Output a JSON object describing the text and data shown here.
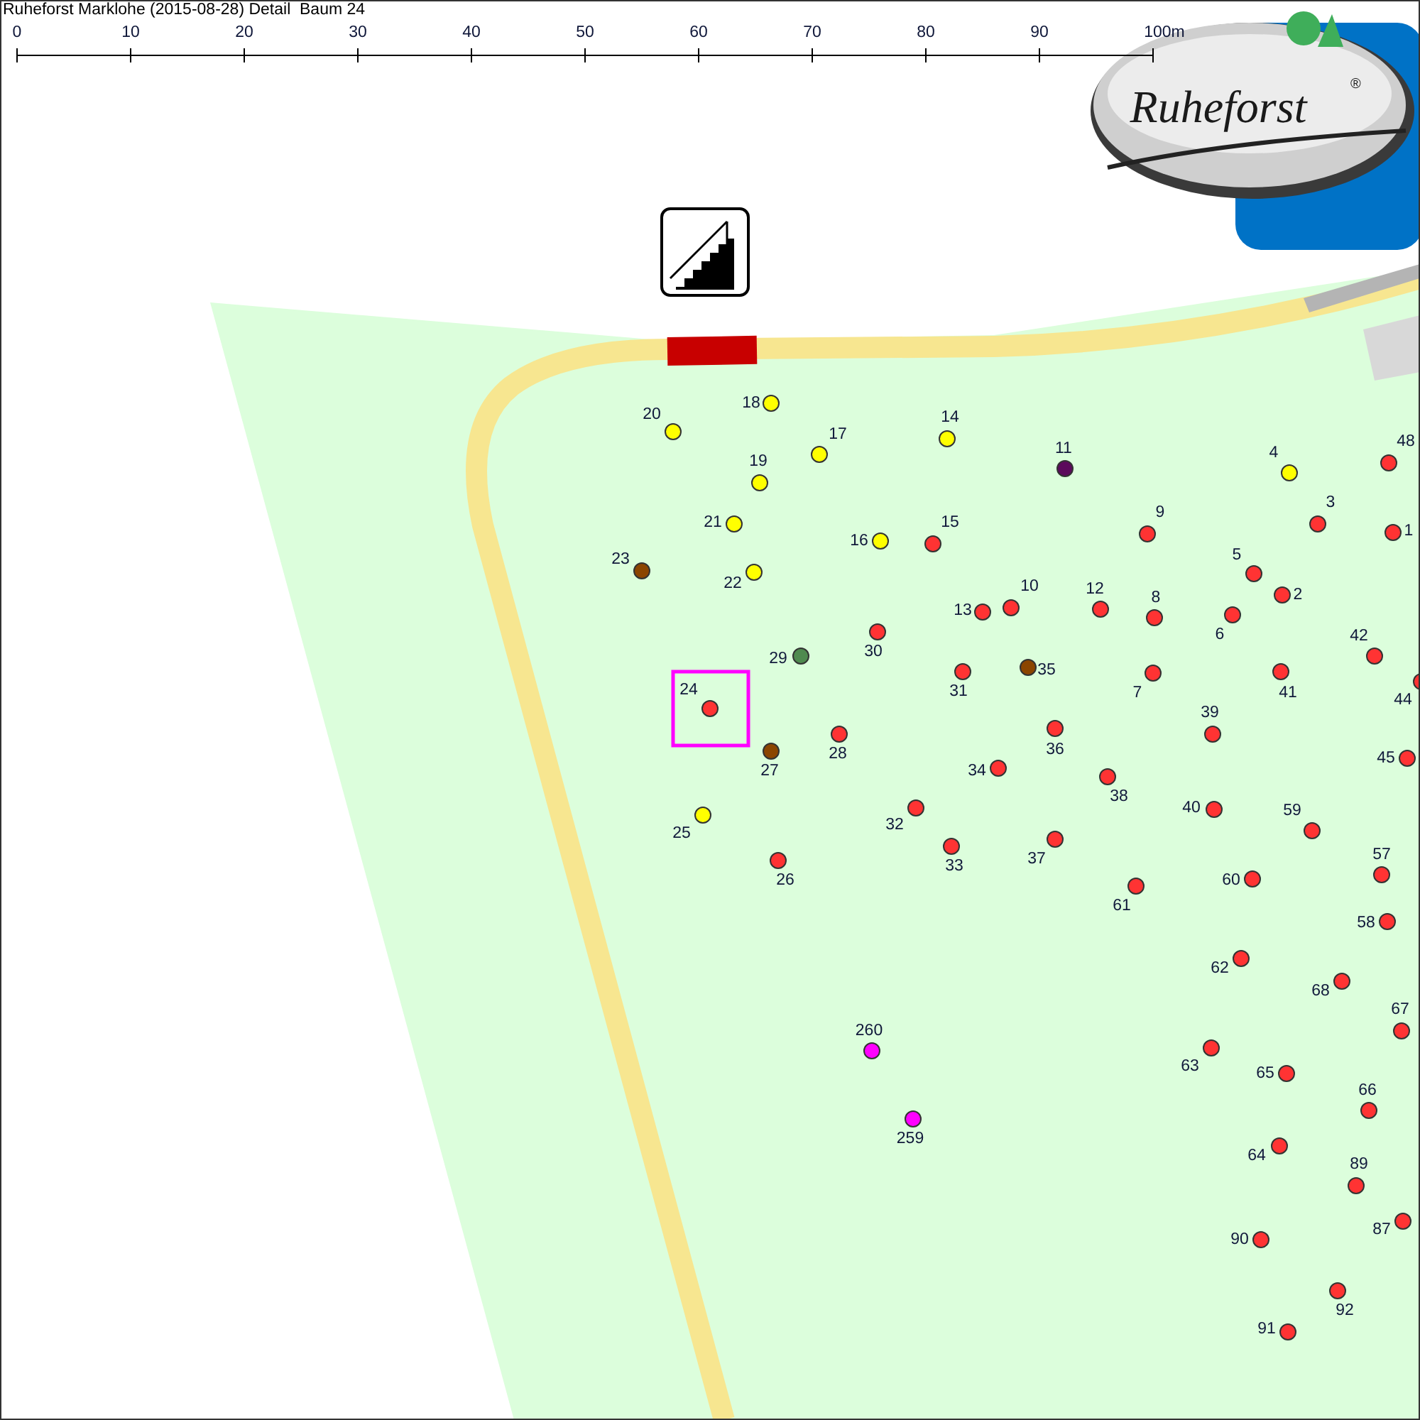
{
  "title": "Ruheforst Marklohe (2015-08-28) Detail  Baum 24",
  "scale_bar": {
    "ticks": [
      "0",
      "10",
      "20",
      "30",
      "40",
      "50",
      "60",
      "70",
      "80",
      "90",
      "100m"
    ]
  },
  "logo": {
    "name": "Ruheforst",
    "mark": "®"
  },
  "trees": [
    {
      "label": "18",
      "color": "#ffff00",
      "selected": false
    },
    {
      "label": "20",
      "color": "#ffff00",
      "selected": false
    },
    {
      "label": "14",
      "color": "#ffff00",
      "selected": false
    },
    {
      "label": "17",
      "color": "#ffff00",
      "selected": false
    },
    {
      "label": "48",
      "color": "#ff3333",
      "selected": false
    },
    {
      "label": "11",
      "color": "#5c0a5c",
      "selected": false
    },
    {
      "label": "4",
      "color": "#ffff00",
      "selected": false
    },
    {
      "label": "19",
      "color": "#ffff00",
      "selected": false
    },
    {
      "label": "21",
      "color": "#ffff00",
      "selected": false
    },
    {
      "label": "3",
      "color": "#ff3333",
      "selected": false
    },
    {
      "label": "1",
      "color": "#ff3333",
      "selected": false
    },
    {
      "label": "9",
      "color": "#ff3333",
      "selected": false
    },
    {
      "label": "16",
      "color": "#ffff00",
      "selected": false
    },
    {
      "label": "15",
      "color": "#ff3333",
      "selected": false
    },
    {
      "label": "23",
      "color": "#8b4500",
      "selected": false
    },
    {
      "label": "22",
      "color": "#ffff00",
      "selected": false
    },
    {
      "label": "5",
      "color": "#ff3333",
      "selected": false
    },
    {
      "label": "2",
      "color": "#ff3333",
      "selected": false
    },
    {
      "label": "10",
      "color": "#ff3333",
      "selected": false
    },
    {
      "label": "12",
      "color": "#ff3333",
      "selected": false
    },
    {
      "label": "13",
      "color": "#ff3333",
      "selected": false
    },
    {
      "label": "6",
      "color": "#ff3333",
      "selected": false
    },
    {
      "label": "8",
      "color": "#ff3333",
      "selected": false
    },
    {
      "label": "30",
      "color": "#ff3333",
      "selected": false
    },
    {
      "label": "29",
      "color": "#4f8a4f",
      "selected": false
    },
    {
      "label": "42",
      "color": "#ff3333",
      "selected": false
    },
    {
      "label": "35",
      "color": "#8b4500",
      "selected": false
    },
    {
      "label": "31",
      "color": "#ff3333",
      "selected": false
    },
    {
      "label": "7",
      "color": "#ff3333",
      "selected": false
    },
    {
      "label": "41",
      "color": "#ff3333",
      "selected": false
    },
    {
      "label": "44",
      "color": "#ff3333",
      "selected": false
    },
    {
      "label": "24",
      "color": "#ff3333",
      "selected": true
    },
    {
      "label": "36",
      "color": "#ff3333",
      "selected": false
    },
    {
      "label": "28",
      "color": "#ff3333",
      "selected": false
    },
    {
      "label": "39",
      "color": "#ff3333",
      "selected": false
    },
    {
      "label": "27",
      "color": "#8b4500",
      "selected": false
    },
    {
      "label": "45",
      "color": "#ff3333",
      "selected": false
    },
    {
      "label": "34",
      "color": "#ff3333",
      "selected": false
    },
    {
      "label": "38",
      "color": "#ff3333",
      "selected": false
    },
    {
      "label": "32",
      "color": "#ff3333",
      "selected": false
    },
    {
      "label": "40",
      "color": "#ff3333",
      "selected": false
    },
    {
      "label": "25",
      "color": "#ffff00",
      "selected": false
    },
    {
      "label": "59",
      "color": "#ff3333",
      "selected": false
    },
    {
      "label": "37",
      "color": "#ff3333",
      "selected": false
    },
    {
      "label": "33",
      "color": "#ff3333",
      "selected": false
    },
    {
      "label": "26",
      "color": "#ff3333",
      "selected": false
    },
    {
      "label": "57",
      "color": "#ff3333",
      "selected": false
    },
    {
      "label": "60",
      "color": "#ff3333",
      "selected": false
    },
    {
      "label": "61",
      "color": "#ff3333",
      "selected": false
    },
    {
      "label": "58",
      "color": "#ff3333",
      "selected": false
    },
    {
      "label": "62",
      "color": "#ff3333",
      "selected": false
    },
    {
      "label": "68",
      "color": "#ff3333",
      "selected": false
    },
    {
      "label": "67",
      "color": "#ff3333",
      "selected": false
    },
    {
      "label": "63",
      "color": "#ff3333",
      "selected": false
    },
    {
      "label": "260",
      "color": "#ff00ff",
      "selected": false
    },
    {
      "label": "65",
      "color": "#ff3333",
      "selected": false
    },
    {
      "label": "66",
      "color": "#ff3333",
      "selected": false
    },
    {
      "label": "259",
      "color": "#ff00ff",
      "selected": false
    },
    {
      "label": "64",
      "color": "#ff3333",
      "selected": false
    },
    {
      "label": "89",
      "color": "#ff3333",
      "selected": false
    },
    {
      "label": "87",
      "color": "#ff3333",
      "selected": false
    },
    {
      "label": "90",
      "color": "#ff3333",
      "selected": false
    },
    {
      "label": "92",
      "color": "#ff3333",
      "selected": false
    },
    {
      "label": "91",
      "color": "#ff3333",
      "selected": false
    }
  ]
}
